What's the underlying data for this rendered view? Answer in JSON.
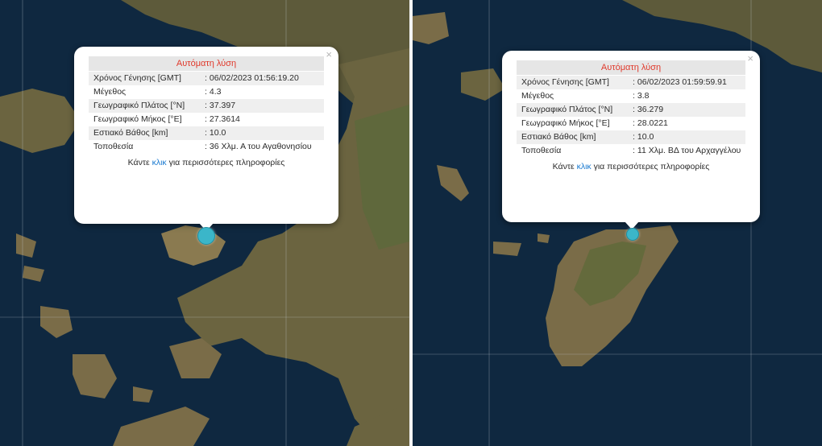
{
  "colors": {
    "sea": "#0f2840",
    "land": "#6b6440",
    "popup_title": "#e0392b",
    "link": "#1a7ad0",
    "marker": "#3bb6c9"
  },
  "left": {
    "popup": {
      "title": "Αυτόματη λύση",
      "close": "×",
      "rows": [
        {
          "label": "Χρόνος Γένησης [GMT]",
          "value": "06/02/2023 01:56:19.20"
        },
        {
          "label": "Μέγεθος",
          "value": "4.3"
        },
        {
          "label": "Γεωγραφικό Πλάτος [°N]",
          "value": "37.397"
        },
        {
          "label": "Γεωγραφικό Μήκος [°E]",
          "value": "27.3614"
        },
        {
          "label": "Εστιακό Βάθος [km]",
          "value": "10.0"
        },
        {
          "label": "Τοποθεσία",
          "value": "36 Χλμ. Α του Αγαθονησίου"
        }
      ],
      "more_prefix": "Κάντε",
      "more_link": "κλικ",
      "more_suffix": "για περισσότερες πληροφορίες"
    }
  },
  "right": {
    "popup": {
      "title": "Αυτόματη λύση",
      "close": "×",
      "rows": [
        {
          "label": "Χρόνος Γένησης [GMT]",
          "value": "06/02/2023 01:59:59.91"
        },
        {
          "label": "Μέγεθος",
          "value": "3.8"
        },
        {
          "label": "Γεωγραφικό Πλάτος [°N]",
          "value": "36.279"
        },
        {
          "label": "Γεωγραφικό Μήκος [°E]",
          "value": "28.0221"
        },
        {
          "label": "Εστιακό Βάθος [km]",
          "value": "10.0"
        },
        {
          "label": "Τοποθεσία",
          "value": "11 Χλμ. ΒΔ του Αρχαγγέλου"
        }
      ],
      "more_prefix": "Κάντε",
      "more_link": "κλικ",
      "more_suffix": "για περισσότερες πληροφορίες"
    }
  }
}
